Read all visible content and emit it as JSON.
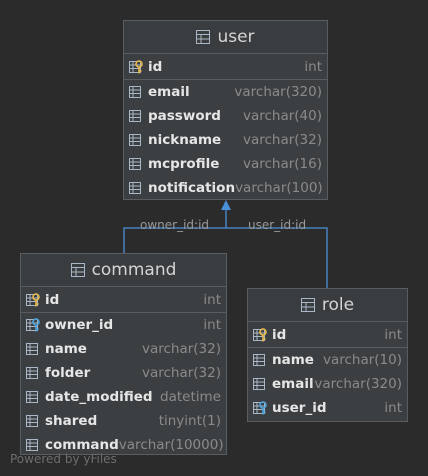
{
  "tables": {
    "user": {
      "name": "user",
      "fields": [
        {
          "name": "id",
          "type": "int",
          "kind": "pk"
        },
        {
          "name": "email",
          "type": "varchar(320)",
          "kind": "col"
        },
        {
          "name": "password",
          "type": "varchar(40)",
          "kind": "col"
        },
        {
          "name": "nickname",
          "type": "varchar(32)",
          "kind": "col"
        },
        {
          "name": "mcprofile",
          "type": "varchar(16)",
          "kind": "col"
        },
        {
          "name": "notification",
          "type": "varchar(100)",
          "kind": "col"
        }
      ]
    },
    "command": {
      "name": "command",
      "fields": [
        {
          "name": "id",
          "type": "int",
          "kind": "pk"
        },
        {
          "name": "owner_id",
          "type": "int",
          "kind": "fk"
        },
        {
          "name": "name",
          "type": "varchar(32)",
          "kind": "col"
        },
        {
          "name": "folder",
          "type": "varchar(32)",
          "kind": "col"
        },
        {
          "name": "date_modified",
          "type": "datetime",
          "kind": "col"
        },
        {
          "name": "shared",
          "type": "tinyint(1)",
          "kind": "col"
        },
        {
          "name": "command",
          "type": "varchar(10000)",
          "kind": "col"
        }
      ]
    },
    "role": {
      "name": "role",
      "fields": [
        {
          "name": "id",
          "type": "int",
          "kind": "pk"
        },
        {
          "name": "name",
          "type": "varchar(10)",
          "kind": "col"
        },
        {
          "name": "email",
          "type": "varchar(320)",
          "kind": "col"
        },
        {
          "name": "user_id",
          "type": "int",
          "kind": "fk"
        }
      ]
    }
  },
  "relations": {
    "command_owner": "owner_id:id",
    "role_user": "user_id:id"
  },
  "watermark": "Powered by yFiles",
  "colors": {
    "edge": "#4a90d9",
    "pk_key": "#e8b84a",
    "fk_key": "#4aa3df",
    "column_icon": "#a9b7c6"
  }
}
